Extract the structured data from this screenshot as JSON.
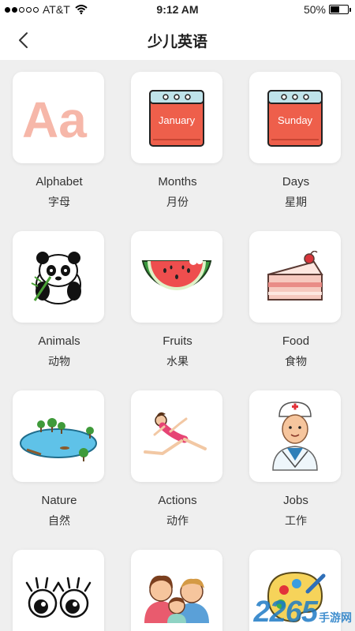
{
  "status_bar": {
    "carrier": "AT&T",
    "time": "9:12 AM",
    "battery": "50%",
    "battery_level": 0.5
  },
  "nav": {
    "title": "少儿英语",
    "back_icon": "chevron-left-icon"
  },
  "categories": [
    {
      "en": "Alphabet",
      "cn": "字母",
      "icon_text": "Aa",
      "icon": "alphabet-icon"
    },
    {
      "en": "Months",
      "cn": "月份",
      "icon_text": "January",
      "icon": "calendar-icon"
    },
    {
      "en": "Days",
      "cn": "星期",
      "icon_text": "Sunday",
      "icon": "calendar-icon"
    },
    {
      "en": "Animals",
      "cn": "动物",
      "icon": "panda-icon"
    },
    {
      "en": "Fruits",
      "cn": "水果",
      "icon": "watermelon-icon"
    },
    {
      "en": "Food",
      "cn": "食物",
      "icon": "cake-icon"
    },
    {
      "en": "Nature",
      "cn": "自然",
      "icon": "lake-icon"
    },
    {
      "en": "Actions",
      "cn": "动作",
      "icon": "gymnast-icon"
    },
    {
      "en": "Jobs",
      "cn": "工作",
      "icon": "doctor-icon"
    },
    {
      "icon": "eyes-icon"
    },
    {
      "icon": "family-icon"
    },
    {
      "icon": "palette-icon"
    }
  ],
  "watermark": {
    "number": "2265",
    "text": "手游网"
  },
  "colors": {
    "accent_red": "#ee5f4b",
    "tile_bg": "#ffffff",
    "page_bg": "#efefef"
  }
}
